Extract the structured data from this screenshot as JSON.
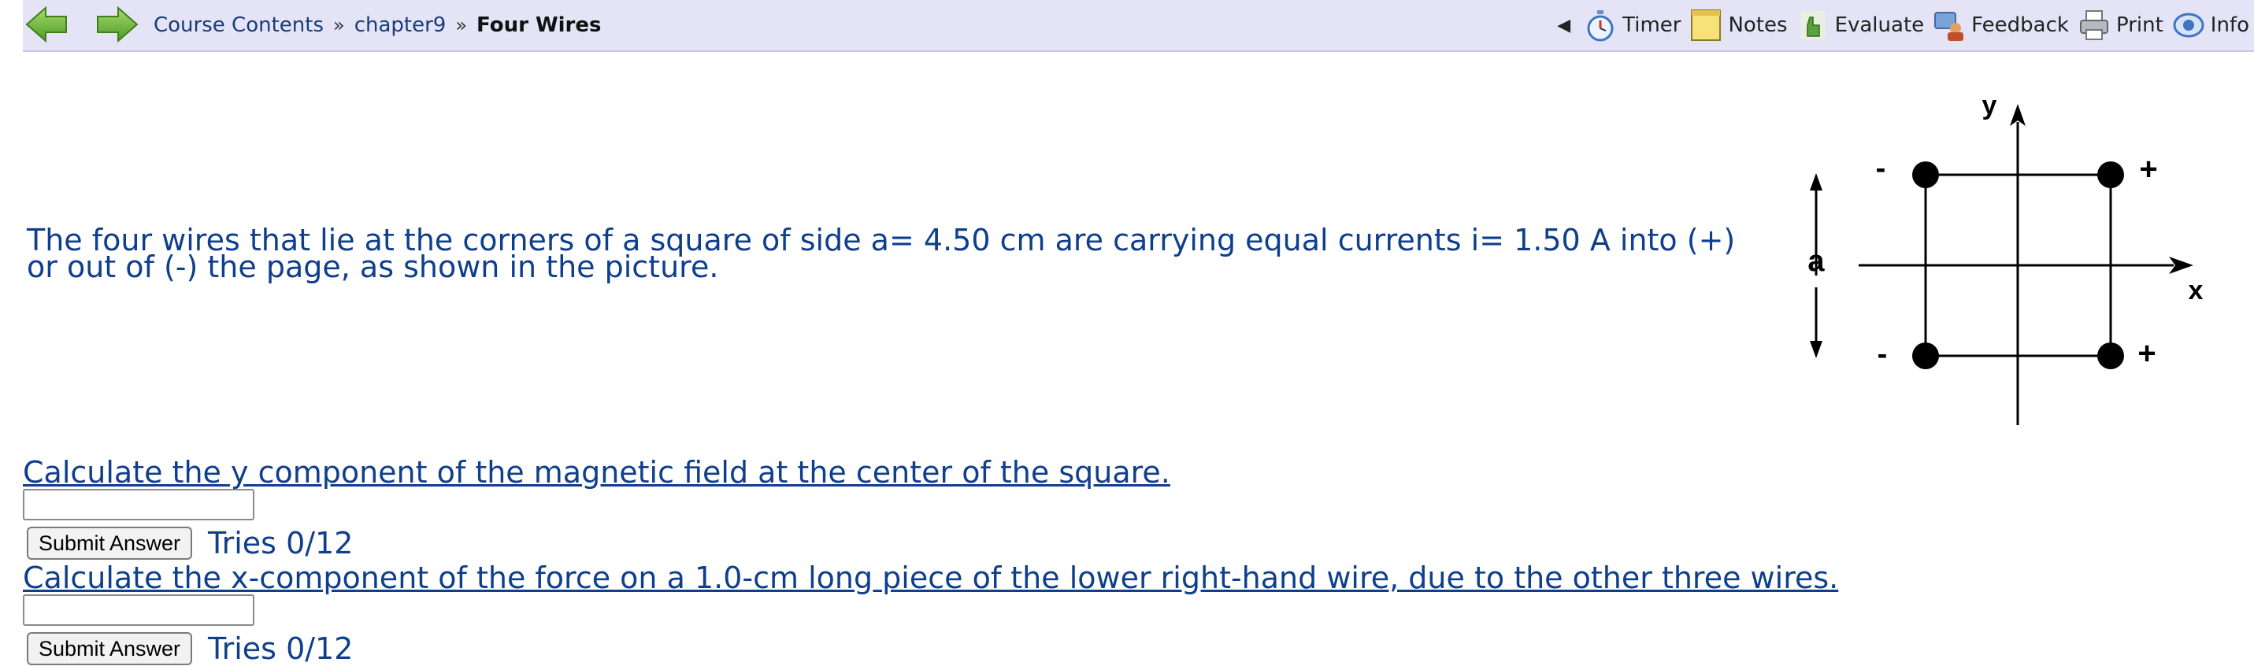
{
  "nav": {
    "breadcrumb": [
      "Course Contents",
      "chapter9",
      "Four Wires"
    ],
    "separator": "»",
    "collapse_symbol": "◀",
    "tools": [
      "Timer",
      "Notes",
      "Evaluate",
      "Feedback",
      "Print",
      "Info"
    ]
  },
  "problem": {
    "text": "The four wires that lie at the corners of a square of side a= 4.50 cm are carrying equal currents i= 1.50 A into (+) or out of (-) the page, as shown in the picture."
  },
  "figure": {
    "axis_x_label": "x",
    "axis_y_label": "y",
    "side_label": "a",
    "corner_signs": {
      "top_left": "-",
      "top_right": "+",
      "bottom_left": "-",
      "bottom_right": "+"
    }
  },
  "questions": [
    {
      "prompt": "Calculate the y component of the magnetic field at the center of the square.",
      "submit_label": "Submit Answer",
      "tries": "Tries 0/12",
      "value": ""
    },
    {
      "prompt": "Calculate the x-component of the force on a 1.0-cm long piece of the lower right-hand wire, due to the other three wires.",
      "submit_label": "Submit Answer",
      "tries": "Tries 0/12",
      "value": ""
    }
  ],
  "colors": {
    "nav_bg": "#e4e4f6",
    "text_blue": "#0f3f8c",
    "arrow_green": "#7cbd3d"
  }
}
